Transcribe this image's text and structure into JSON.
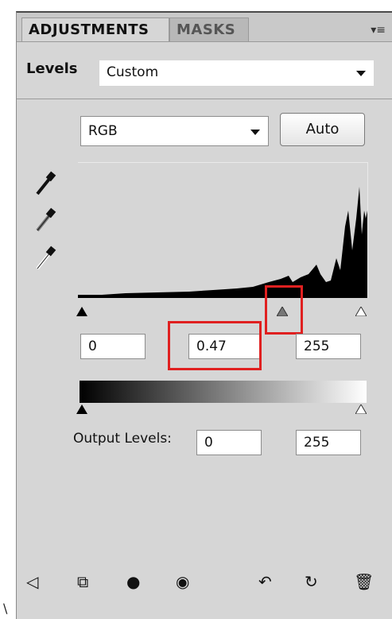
{
  "tabs": [
    "ADJUSTMENTS",
    "MASKS"
  ],
  "levels": {
    "title": "Levels",
    "preset": "Custom",
    "channel": "RGB",
    "auto_label": "Auto",
    "input_black": "0",
    "input_gamma": "0.47",
    "input_white": "255",
    "output_label": "Output Levels:",
    "output_black": "0",
    "output_white": "255"
  },
  "icons": {
    "panel_menu": "panel-menu-icon",
    "eyedroppers": [
      "black-eyedropper-icon",
      "gray-eyedropper-icon",
      "white-eyedropper-icon"
    ],
    "footer": [
      "back-arrow-icon",
      "expand-view-icon",
      "clip-to-layer-icon",
      "visibility-eye-icon",
      "previous-state-icon",
      "reset-icon",
      "delete-icon"
    ]
  },
  "colors": {
    "highlight_box": "#e02020",
    "panel_bg": "#d6d6d6"
  },
  "stray_text": "\\"
}
